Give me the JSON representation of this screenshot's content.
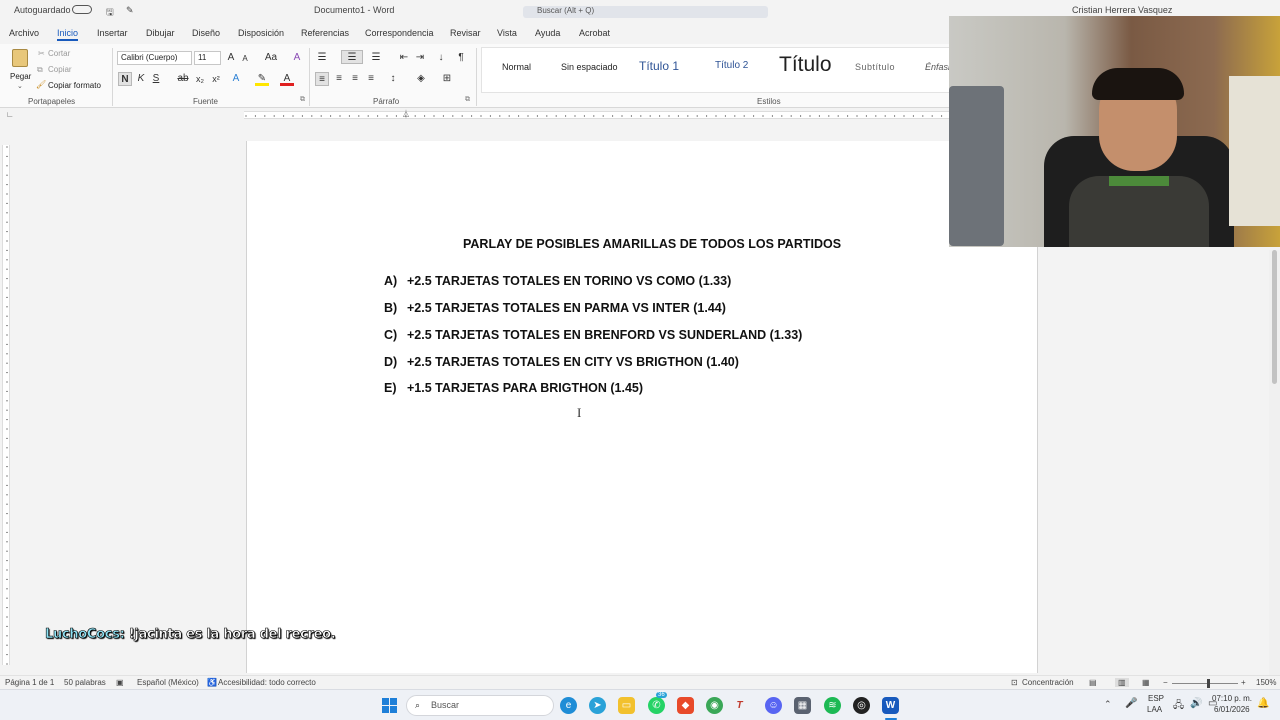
{
  "titlebar": {
    "autosave": "Autoguardado",
    "doc_title": "Documento1 - Word",
    "search_placeholder": "Buscar (Alt + Q)",
    "user": "Cristian Herrera Vasquez"
  },
  "tabs": [
    "Archivo",
    "Inicio",
    "Insertar",
    "Dibujar",
    "Diseño",
    "Disposición",
    "Referencias",
    "Correspondencia",
    "Revisar",
    "Vista",
    "Ayuda",
    "Acrobat"
  ],
  "ribbon": {
    "paste": "Pegar",
    "cut": "Cortar",
    "copy": "Copiar",
    "format_painter": "Copiar formato",
    "clipboard_label": "Portapapeles",
    "font_name": "Calibri (Cuerpo)",
    "font_size": "11",
    "font_label": "Fuente",
    "paragraph_label": "Párrafo",
    "styles_label": "Estilos",
    "styles": [
      "Normal",
      "Sin espaciado",
      "Título 1",
      "Título 2",
      "Título",
      "Subtítulo",
      "Énfasis"
    ]
  },
  "document": {
    "title": "PARLAY DE POSIBLES AMARILLAS DE TODOS LOS PARTIDOS",
    "items": [
      {
        "letter": "A)",
        "text": "+2.5 TARJETAS TOTALES EN TORINO VS COMO (1.33)"
      },
      {
        "letter": "B)",
        "text": "+2.5 TARJETAS TOTALES EN PARMA VS INTER (1.44)"
      },
      {
        "letter": "C)",
        "text": "+2.5 TARJETAS TOTALES EN BRENFORD VS SUNDERLAND (1.33)"
      },
      {
        "letter": "D)",
        "text": "+2.5 TARJETAS TOTALES EN CITY VS BRIGTHON (1.40)"
      },
      {
        "letter": "E)",
        "text": "+1.5 TARJETAS PARA BRIGTHON (1.45)"
      }
    ]
  },
  "chat": {
    "user": "LuchoCocs:",
    "message": "!jacinta es la hora del recreo."
  },
  "statusbar": {
    "page": "Página 1 de 1",
    "words": "50 palabras",
    "language": "Español (México)",
    "accessibility": "Accesibilidad: todo correcto",
    "focus": "Concentración",
    "zoom": "150%"
  },
  "taskbar": {
    "search": "Buscar",
    "lang_top": "ESP",
    "lang_bottom": "LAA",
    "time": "07:10 p. m.",
    "date": "6/01/2026",
    "whatsapp_badge": "36"
  }
}
